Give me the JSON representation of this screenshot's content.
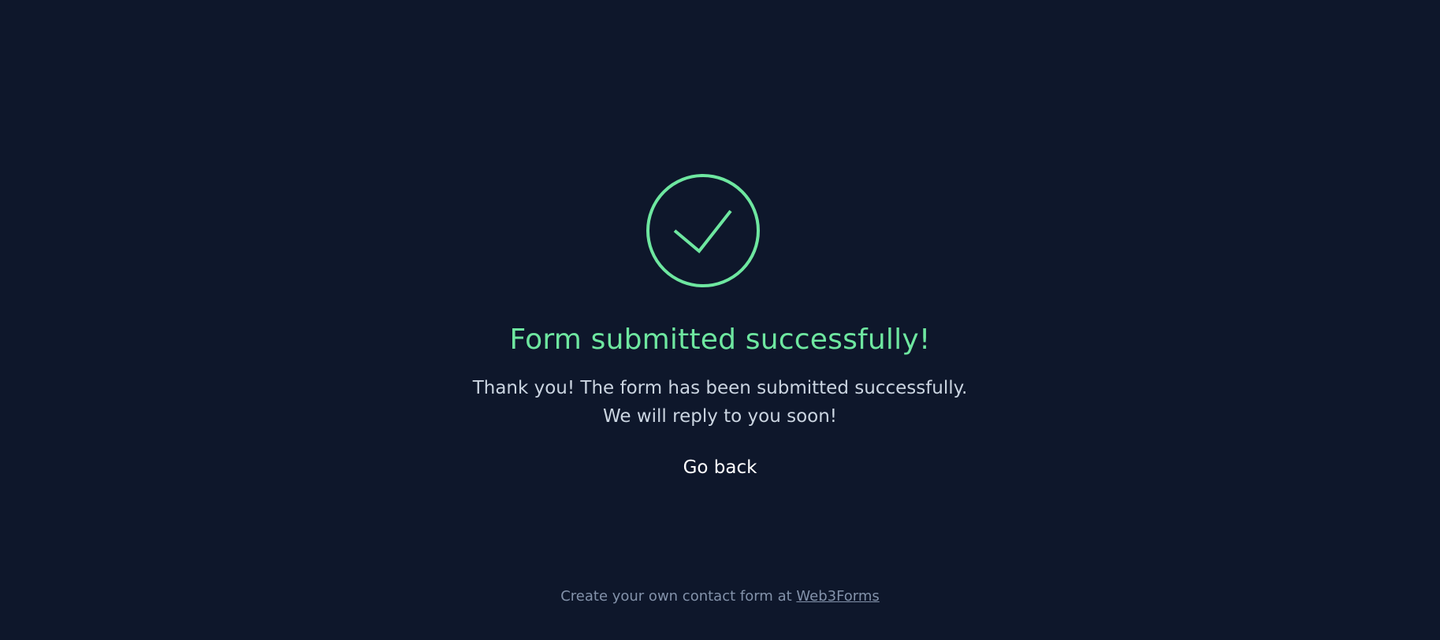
{
  "colors": {
    "background": "#0e172b",
    "accent": "#6ee7a0",
    "message_text": "#cbd5e1",
    "link_text": "#ffffff",
    "footer_text": "#8392aa"
  },
  "icon": {
    "name": "check-circle-icon"
  },
  "title": "Form submitted successfully!",
  "message": {
    "line1": "Thank you! The form has been submitted successfully.",
    "line2": "We will reply to you soon!"
  },
  "go_back_label": "Go back",
  "footer": {
    "prefix": "Create your own contact form at",
    "link_label": "Web3Forms"
  }
}
